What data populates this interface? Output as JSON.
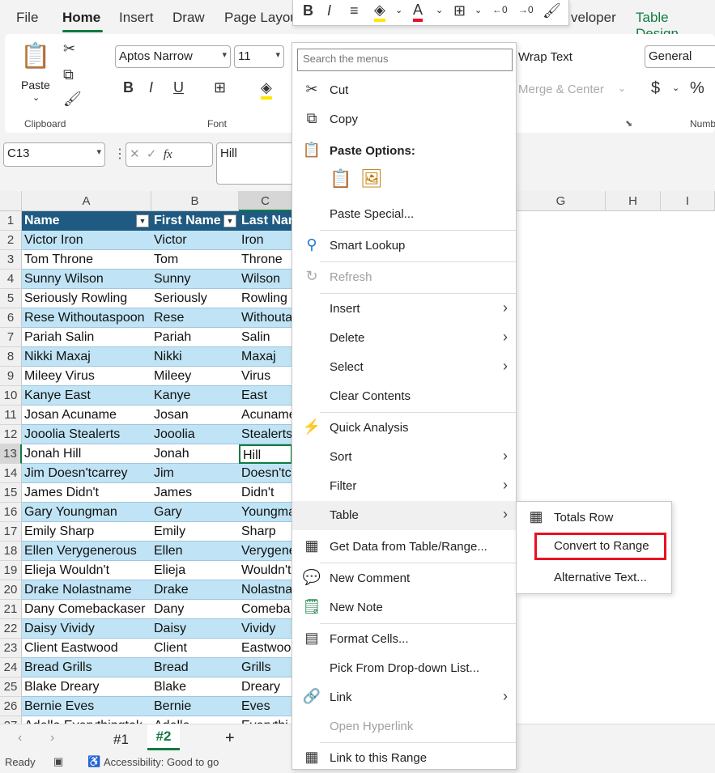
{
  "tabs": [
    "File",
    "Home",
    "Insert",
    "Draw",
    "Page Layou",
    "veloper",
    "Table Design"
  ],
  "clipboard": {
    "paste": "Paste",
    "label": "Clipboard"
  },
  "font": {
    "family": "Aptos Narrow",
    "size": "11",
    "label": "Font"
  },
  "alignment": {
    "wrap": "Wrap Text",
    "merge": "Merge & Center"
  },
  "number": {
    "format": "General",
    "label": "Numb"
  },
  "formula": {
    "namebox": "C13",
    "value": "Hill",
    "fx": "fx"
  },
  "columns": [
    "A",
    "B",
    "C",
    "G",
    "H",
    "I"
  ],
  "headers": [
    "Name",
    "First Name",
    "Last Nam"
  ],
  "rows": [
    [
      "Victor Iron",
      "Victor",
      "Iron"
    ],
    [
      "Tom Throne",
      "Tom",
      "Throne"
    ],
    [
      "Sunny Wilson",
      "Sunny",
      "Wilson"
    ],
    [
      "Seriously Rowling",
      "Seriously",
      "Rowling"
    ],
    [
      "Rese Withoutaspoon",
      "Rese",
      "Withouta"
    ],
    [
      "Pariah Salin",
      "Pariah",
      "Salin"
    ],
    [
      "Nikki Maxaj",
      "Nikki",
      "Maxaj"
    ],
    [
      "Mileey Virus",
      "Mileey",
      "Virus"
    ],
    [
      "Kanye East",
      "Kanye",
      "East"
    ],
    [
      "Josan Acuname",
      "Josan",
      "Acuname"
    ],
    [
      "Jooolia Stealerts",
      "Jooolia",
      "Stealerts"
    ],
    [
      "Jonah Hill",
      "Jonah",
      "Hill"
    ],
    [
      "Jim Doesn'tcarrey",
      "Jim",
      "Doesn'tc"
    ],
    [
      "James Didn't",
      "James",
      "Didn't"
    ],
    [
      "Gary Youngman",
      "Gary",
      "Youngma"
    ],
    [
      "Emily Sharp",
      "Emily",
      "Sharp"
    ],
    [
      "Ellen Verygenerous",
      "Ellen",
      "Verygene"
    ],
    [
      "Elieja Wouldn't",
      "Elieja",
      "Wouldn't"
    ],
    [
      "Drake Nolastname",
      "Drake",
      "Nolastna"
    ],
    [
      "Dany Comebackaser",
      "Dany",
      "Comeba"
    ],
    [
      "Daisy Vividy",
      "Daisy",
      "Vividy"
    ],
    [
      "Client Eastwood",
      "Client",
      "Eastwoo"
    ],
    [
      "Bread Grills",
      "Bread",
      "Grills"
    ],
    [
      "Blake Dreary",
      "Blake",
      "Dreary"
    ],
    [
      "Bernie Eves",
      "Bernie",
      "Eves"
    ],
    [
      "Adella Everythingtok",
      "Adella",
      "Everythi"
    ]
  ],
  "rownums": [
    "1",
    "2",
    "3",
    "4",
    "5",
    "6",
    "7",
    "8",
    "9",
    "10",
    "11",
    "12",
    "13",
    "14",
    "15",
    "16",
    "17",
    "18",
    "19",
    "20",
    "21",
    "22",
    "23",
    "24",
    "25",
    "26",
    "27"
  ],
  "sheets": [
    "#1",
    "#2"
  ],
  "status": {
    "ready": "Ready",
    "access": "Accessibility: Good to go"
  },
  "menu": {
    "search_placeholder": "Search the menus",
    "cut": "Cut",
    "copy": "Copy",
    "paste_options": "Paste Options:",
    "paste_special": "Paste Special...",
    "smart_lookup": "Smart Lookup",
    "refresh": "Refresh",
    "insert": "Insert",
    "delete": "Delete",
    "select": "Select",
    "clear": "Clear Contents",
    "quick_analysis": "Quick Analysis",
    "sort": "Sort",
    "filter": "Filter",
    "table": "Table",
    "get_data": "Get Data from Table/Range...",
    "new_comment": "New Comment",
    "new_note": "New Note",
    "format_cells": "Format Cells...",
    "pick": "Pick From Drop-down List...",
    "link": "Link",
    "open_hyperlink": "Open Hyperlink",
    "link_range": "Link to this Range"
  },
  "submenu": {
    "totals": "Totals Row",
    "convert": "Convert to Range",
    "alt": "Alternative Text..."
  },
  "colors": {
    "accent": "#107c41",
    "table_header": "#1e5a82",
    "band": "#c0e4f5",
    "highlight": "#e81123"
  }
}
